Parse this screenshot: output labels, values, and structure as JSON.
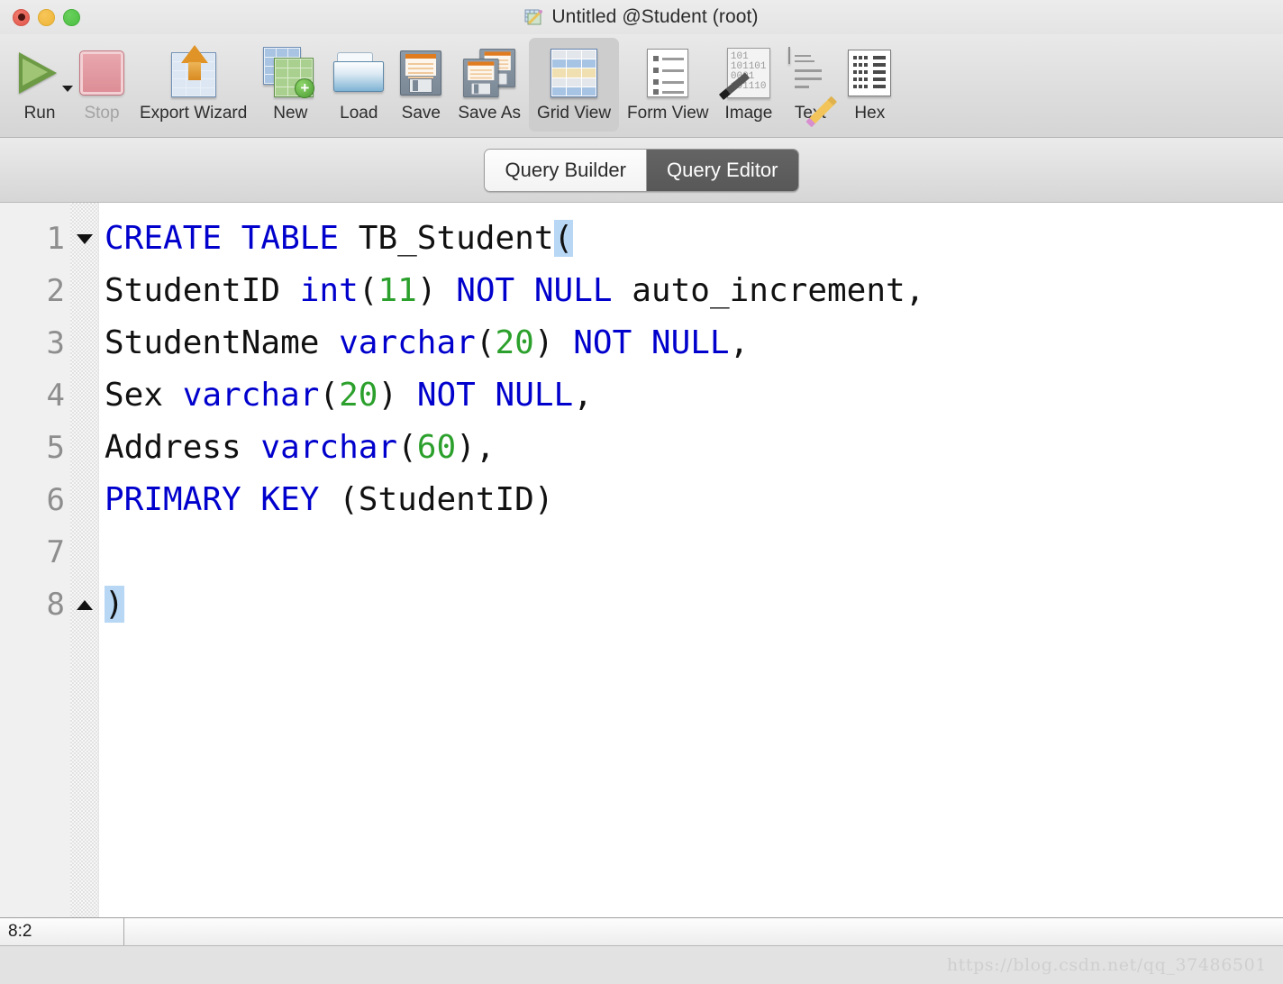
{
  "window": {
    "title": "Untitled @Student (root)",
    "title_icon": "table-pencil-icon",
    "controls": {
      "close": "close-button",
      "minimize": "minimize-button",
      "maximize": "maximize-button"
    }
  },
  "toolbar": {
    "items": [
      {
        "label": "Run",
        "icon": "run-play-icon",
        "selected": false,
        "disabled": false,
        "has_dropdown": true
      },
      {
        "label": "Stop",
        "icon": "stop-square-icon",
        "selected": false,
        "disabled": true,
        "has_dropdown": false
      },
      {
        "label": "Export Wizard",
        "icon": "export-wizard-icon",
        "selected": false,
        "disabled": false,
        "has_dropdown": false
      },
      {
        "label": "New",
        "icon": "new-table-icon",
        "selected": false,
        "disabled": false,
        "has_dropdown": false
      },
      {
        "label": "Load",
        "icon": "load-folder-icon",
        "selected": false,
        "disabled": false,
        "has_dropdown": false
      },
      {
        "label": "Save",
        "icon": "save-floppy-icon",
        "selected": false,
        "disabled": false,
        "has_dropdown": false
      },
      {
        "label": "Save As",
        "icon": "save-as-floppy-icon",
        "selected": false,
        "disabled": false,
        "has_dropdown": false
      },
      {
        "label": "Grid View",
        "icon": "grid-view-icon",
        "selected": true,
        "disabled": false,
        "has_dropdown": false
      },
      {
        "label": "Form View",
        "icon": "form-view-icon",
        "selected": false,
        "disabled": false,
        "has_dropdown": false
      },
      {
        "label": "Image",
        "icon": "image-binary-icon",
        "selected": false,
        "disabled": false,
        "has_dropdown": false
      },
      {
        "label": "Text",
        "icon": "text-pencil-icon",
        "selected": false,
        "disabled": false,
        "has_dropdown": false
      },
      {
        "label": "Hex",
        "icon": "hex-view-icon",
        "selected": false,
        "disabled": false,
        "has_dropdown": false
      }
    ]
  },
  "tabs": [
    {
      "label": "Query Builder",
      "active": false
    },
    {
      "label": "Query Editor",
      "active": true
    }
  ],
  "editor": {
    "line_numbers": [
      "1",
      "2",
      "3",
      "4",
      "5",
      "6",
      "7",
      "8"
    ],
    "fold_markers": {
      "1": "fold-collapse-down",
      "8": "fold-expand-up"
    },
    "lines": [
      {
        "n": 1,
        "tokens": [
          {
            "t": "CREATE TABLE ",
            "c": "kw"
          },
          {
            "t": "TB_Student",
            "c": "id"
          },
          {
            "t": "(",
            "c": "id",
            "hl": true
          }
        ]
      },
      {
        "n": 2,
        "tokens": [
          {
            "t": "StudentID ",
            "c": "id"
          },
          {
            "t": "int",
            "c": "kw"
          },
          {
            "t": "(",
            "c": "id"
          },
          {
            "t": "11",
            "c": "num"
          },
          {
            "t": ") ",
            "c": "id"
          },
          {
            "t": "NOT NULL",
            "c": "kw"
          },
          {
            "t": " auto_increment,",
            "c": "id"
          }
        ]
      },
      {
        "n": 3,
        "tokens": [
          {
            "t": "StudentName ",
            "c": "id"
          },
          {
            "t": "varchar",
            "c": "kw"
          },
          {
            "t": "(",
            "c": "id"
          },
          {
            "t": "20",
            "c": "num"
          },
          {
            "t": ") ",
            "c": "id"
          },
          {
            "t": "NOT NULL",
            "c": "kw"
          },
          {
            "t": ",",
            "c": "id"
          }
        ]
      },
      {
        "n": 4,
        "tokens": [
          {
            "t": "Sex ",
            "c": "id"
          },
          {
            "t": "varchar",
            "c": "kw"
          },
          {
            "t": "(",
            "c": "id"
          },
          {
            "t": "20",
            "c": "num"
          },
          {
            "t": ") ",
            "c": "id"
          },
          {
            "t": "NOT NULL",
            "c": "kw"
          },
          {
            "t": ",",
            "c": "id"
          }
        ]
      },
      {
        "n": 5,
        "tokens": [
          {
            "t": "Address ",
            "c": "id"
          },
          {
            "t": "varchar",
            "c": "kw"
          },
          {
            "t": "(",
            "c": "id"
          },
          {
            "t": "60",
            "c": "num"
          },
          {
            "t": "),",
            "c": "id"
          }
        ]
      },
      {
        "n": 6,
        "tokens": [
          {
            "t": "PRIMARY KEY",
            "c": "kw"
          },
          {
            "t": " (StudentID)",
            "c": "id"
          }
        ]
      },
      {
        "n": 7,
        "tokens": []
      },
      {
        "n": 8,
        "tokens": [
          {
            "t": ")",
            "c": "id",
            "hl": true
          }
        ]
      }
    ],
    "colors": {
      "keyword": "#0000cd",
      "number": "#2ca02c",
      "identifier": "#111111",
      "bracket_highlight": "#b7d7f5",
      "background": "#ffffff",
      "gutter": "#f0f0f0",
      "line_number": "#8e8e8e"
    }
  },
  "statusbar": {
    "cursor_position": "8:2"
  },
  "watermark": {
    "text": "https://blog.csdn.net/qq_37486501"
  }
}
